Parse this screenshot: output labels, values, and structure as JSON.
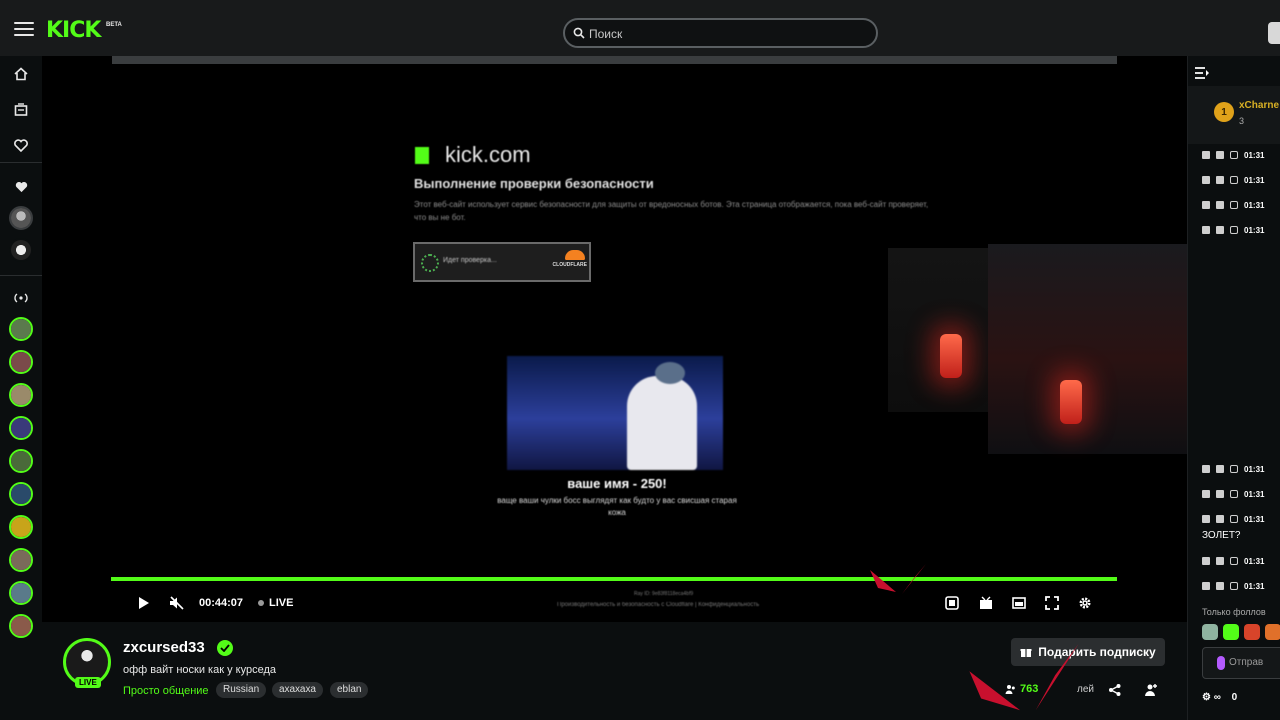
{
  "header": {
    "logo": "KICK",
    "logo_badge": "BETA",
    "search_placeholder": "Поиск"
  },
  "video": {
    "security_page": {
      "brand": "kick.com",
      "title": "Выполнение проверки безопасности",
      "description": "Этот веб-сайт использует сервис безопасности для защиты от вредоносных ботов. Эта страница отображается, пока веб-сайт проверяет, что вы не бот.",
      "checkbox_label": "Идет проверка...",
      "provider": "CLOUDFLARE",
      "ray_id": "Ray ID: 9e83f8118eca4bf9",
      "footer": "Производительность и безопасность с Cloudflare  |  Конфиденциальность"
    },
    "alert": {
      "name": "ваше имя - 250!",
      "message": "ваще ваши чулки босс выглядят как будто у вас свисшая старая кожа"
    },
    "progress": 1.0,
    "time": "00:44:07",
    "live_label": "LIVE"
  },
  "stream": {
    "live_badge": "LIVE",
    "streamer": "zxcursed33",
    "title": "офф вайт носки как у курседа",
    "category": "Просто общение",
    "tags": [
      "Russian",
      "ахахаха",
      "eblan"
    ],
    "subscribe_label": "Подарить подписку",
    "viewers": "763",
    "viewers_suffix": "лей"
  },
  "chat": {
    "pinned_user": "xCharne",
    "pinned_count": "3",
    "pinned_rank": "1",
    "timestamps": [
      "01:31",
      "01:31",
      "01:31",
      "01:31",
      "01:31",
      "01:31",
      "01:31",
      "01:31",
      "01:31"
    ],
    "message_fragment": "ЗОЛЕТ?",
    "follow_only": "Только фоллов",
    "input_placeholder": "Отправ",
    "bottom_count": "0"
  },
  "colors": {
    "accent": "#53fc18",
    "background": "#0b0e0f",
    "panel": "#181a1b"
  }
}
